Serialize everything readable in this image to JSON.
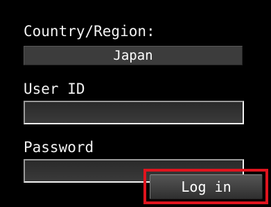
{
  "login_form": {
    "country_label": "Country/Region:",
    "country_value": "Japan",
    "user_id_label": "User ID",
    "user_id_value": "",
    "password_label": "Password",
    "password_value": "",
    "login_button": "Log in"
  },
  "colors": {
    "background": "#000000",
    "highlight_frame": "#e0141e",
    "field_fill": "#3c3c3c",
    "text": "#ffffff"
  }
}
